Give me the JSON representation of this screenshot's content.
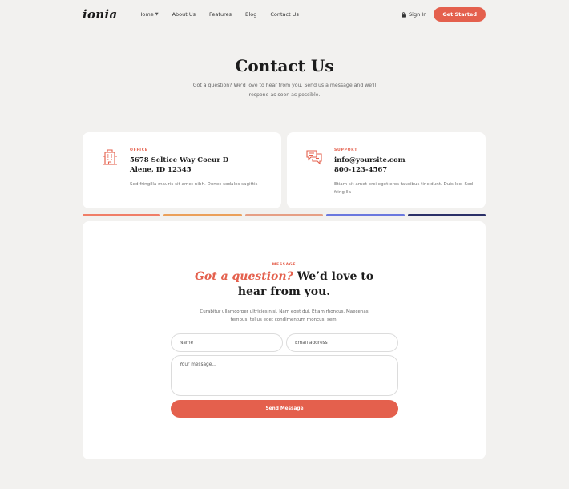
{
  "nav": {
    "logo": "ionia",
    "items": [
      {
        "label": "Home",
        "has_dropdown": true
      },
      {
        "label": "About Us"
      },
      {
        "label": "Features"
      },
      {
        "label": "Blog"
      },
      {
        "label": "Contact Us"
      }
    ],
    "signin_label": "Sign In",
    "cta_label": "Get Started"
  },
  "hero": {
    "title": "Contact Us",
    "subtitle": "Got a question? We'd love to hear from you. Send us a message and we'll respond as soon as possible."
  },
  "cards": {
    "office": {
      "eyebrow": "OFFICE",
      "line1": "5678 Seltice Way Coeur D",
      "line2": "Alene, ID 12345",
      "text": "Sed fringilla mauris sit amet nibh. Donec sodales sagittis"
    },
    "support": {
      "eyebrow": "SUPPORT",
      "line1": "info@yoursite.com",
      "line2": "800-123-4567",
      "text": "Etiam sit amet orci eget eros faucibus tincidunt. Duis leo. Sed fringilla"
    }
  },
  "bars": [
    "#f07e67",
    "#eba05a",
    "#e69f85",
    "#6a78de",
    "#2b3068"
  ],
  "form": {
    "eyebrow": "MESSAGE",
    "title_accent": "Got a question?",
    "title_rest": " We’d love to hear from you.",
    "description": "Curabitur ullamcorper ultricies nisi. Nam eget dui. Etiam rhoncus. Maecenas tempus, tellus eget condimentum rhoncus, sem.",
    "name_placeholder": "Name",
    "email_placeholder": "Email address",
    "message_placeholder": "Your message...",
    "submit_label": "Send Message"
  },
  "colors": {
    "accent": "#e4604d",
    "background": "#f2f1ef"
  },
  "icons": {
    "office": "building-icon",
    "support": "chat-bubbles-icon",
    "signin": "lock-icon"
  }
}
